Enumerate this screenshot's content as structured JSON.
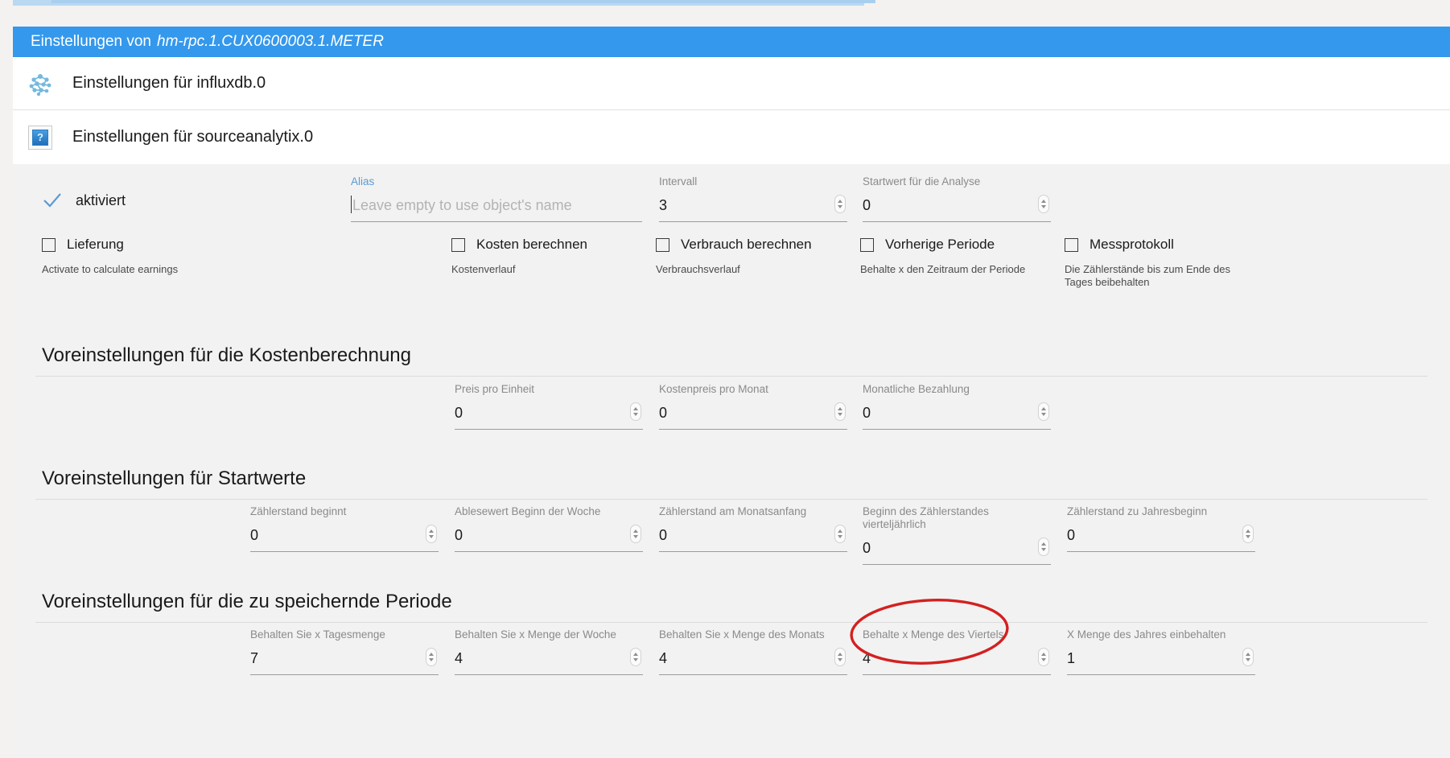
{
  "titlebar": {
    "prefix": "Einstellungen von",
    "object": "hm-rpc.1.CUX0600003.1.METER",
    "bg_color": "#3498ec"
  },
  "adapter_rows": [
    {
      "icon": "influxdb-molecule-icon",
      "label": "Einstellungen für influxdb.0"
    },
    {
      "icon": "broken-image-icon",
      "label": "Einstellungen für sourceanalytix.0"
    }
  ],
  "top_row": {
    "activated": {
      "label": "aktiviert",
      "icon": "check-icon",
      "checked": true
    },
    "fields": [
      {
        "label": "Alias",
        "value": "",
        "placeholder": "Leave empty to use object's name",
        "focused": true,
        "spinner": false
      },
      {
        "label": "Intervall",
        "value": "3",
        "placeholder": "",
        "focused": false,
        "spinner": true
      },
      {
        "label": "Startwert für die Analyse",
        "value": "0",
        "placeholder": "",
        "focused": false,
        "spinner": true
      }
    ]
  },
  "checkboxes": [
    {
      "label": "Lieferung",
      "help": "Activate to calculate earnings",
      "checked": false
    },
    {
      "label": "Kosten berechnen",
      "help": "Kostenverlauf",
      "checked": false
    },
    {
      "label": "Verbrauch berechnen",
      "help": "Verbrauchsverlauf",
      "checked": false
    },
    {
      "label": "Vorherige Periode",
      "help": "Behalte x den Zeitraum der Periode",
      "checked": false
    },
    {
      "label": "Messprotokoll",
      "help": "Die Zählerstände bis zum Ende des Tages beibehalten",
      "checked": false
    }
  ],
  "sections": [
    {
      "title": "Voreinstellungen für die Kostenberechnung",
      "fields": [
        {
          "label": "Preis pro Einheit",
          "value": "0"
        },
        {
          "label": "Kostenpreis pro Monat",
          "value": "0"
        },
        {
          "label": "Monatliche Bezahlung",
          "value": "0"
        }
      ]
    },
    {
      "title": "Voreinstellungen für Startwerte",
      "fields": [
        {
          "label": "Zählerstand beginnt",
          "value": "0"
        },
        {
          "label": "Ablesewert Beginn der Woche",
          "value": "0"
        },
        {
          "label": "Zählerstand am Monatsanfang",
          "value": "0"
        },
        {
          "label": "Beginn des Zählerstandes vierteljährlich",
          "value": "0"
        },
        {
          "label": "Zählerstand zu Jahresbeginn",
          "value": "0"
        }
      ]
    },
    {
      "title": "Voreinstellungen für die zu speichernde Periode",
      "fields": [
        {
          "label": "Behalten Sie x Tagesmenge",
          "value": "7"
        },
        {
          "label": "Behalten Sie x Menge der Woche",
          "value": "4"
        },
        {
          "label": "Behalten Sie x Menge des Monats",
          "value": "4"
        },
        {
          "label": "Behalte x Menge des Viertels",
          "value": "4"
        },
        {
          "label": "X Menge des Jahres einbehalten",
          "value": "1"
        }
      ]
    }
  ],
  "annotation": {
    "name": "red-ellipse-highlight",
    "color": "#d32020",
    "target_label": "Behalte x Menge des Viertels"
  }
}
